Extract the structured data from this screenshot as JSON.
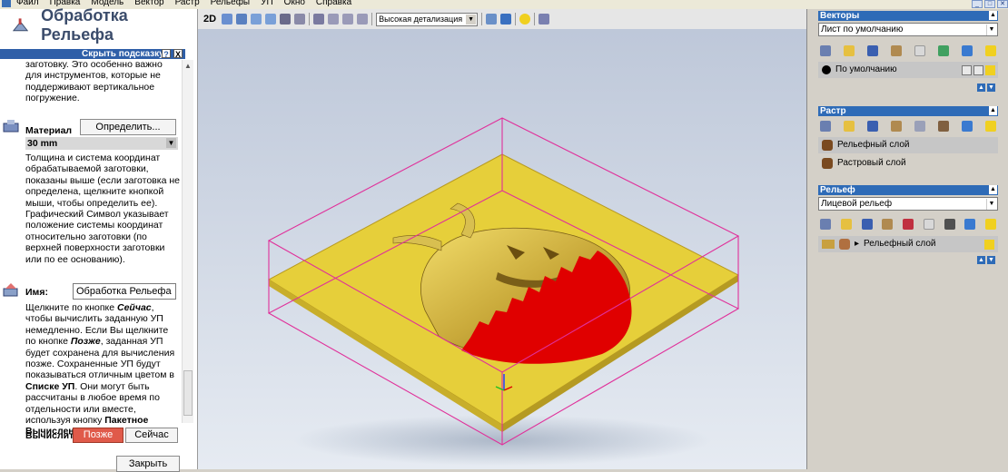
{
  "menu": [
    "Файл",
    "Правка",
    "Модель",
    "Вектор",
    "Растр",
    "Рельефы",
    "УП",
    "Окно",
    "Справка"
  ],
  "window_buttons": [
    "_",
    "□",
    "✕"
  ],
  "left": {
    "title": "Обработка Рельефа",
    "hint_bar": "Скрыть подсказку",
    "help_btn": "?",
    "close_btn": "X",
    "intro_text": "заготовку. Это особенно важно для инструментов, которые не поддерживают вертикальное погружение.",
    "material_label": "Материал",
    "material_button": "Определить...",
    "material_value": "30 mm",
    "material_text": "Толщина и система координат обрабатываемой заготовки, показаны выше (если заготовка не определена, щелкните кнопкой мыши, чтобы определить ее). Графический Символ указывает положение системы координат относительно заготовки (по верхней поверхности заготовки или по ее основанию).",
    "name_label": "Имя:",
    "name_value": "Обработка Рельефа",
    "calc_text_1": "Щелкните по кнопке ",
    "calc_now_i": "Сейчас",
    "calc_text_2": ", чтобы вычислить заданную УП немедленно. Если Вы щелкните по кнопке ",
    "calc_later_i": "Позже",
    "calc_text_3": ", заданная УП будет сохранена для вычисления позже. Сохраненные УП будут показываться отличным цветом в ",
    "calc_list_b": "Списке УП",
    "calc_text_4": ". Они могут быть рассчитаны в любое время по отдельности или вместе, используя кнопку ",
    "calc_batch_b": "Пакетное Вычисление УП",
    "calc_text_5": ".",
    "calc_label": "Вычислить",
    "later_button": "Позже",
    "now_button": "Сейчас",
    "close_button": "Закрыть"
  },
  "viewport": {
    "mode_label": "2D",
    "detail_select": "Высокая детализация"
  },
  "right": {
    "vectors": {
      "header": "Векторы",
      "sheet": "Лист по умолчанию",
      "layer": "По умолчанию"
    },
    "raster": {
      "header": "Растр",
      "layers": [
        "Рельефный слой",
        "Растровый слой"
      ]
    },
    "relief": {
      "header": "Рельеф",
      "select": "Лицевой рельеф",
      "layer": "Рельефный слой"
    }
  },
  "colors": {
    "accent": "#2e6bb7",
    "relief_red": "#e00000",
    "material": "#e6cf3a",
    "bbox": "#e0309a",
    "later_btn": "#e05a4a"
  }
}
